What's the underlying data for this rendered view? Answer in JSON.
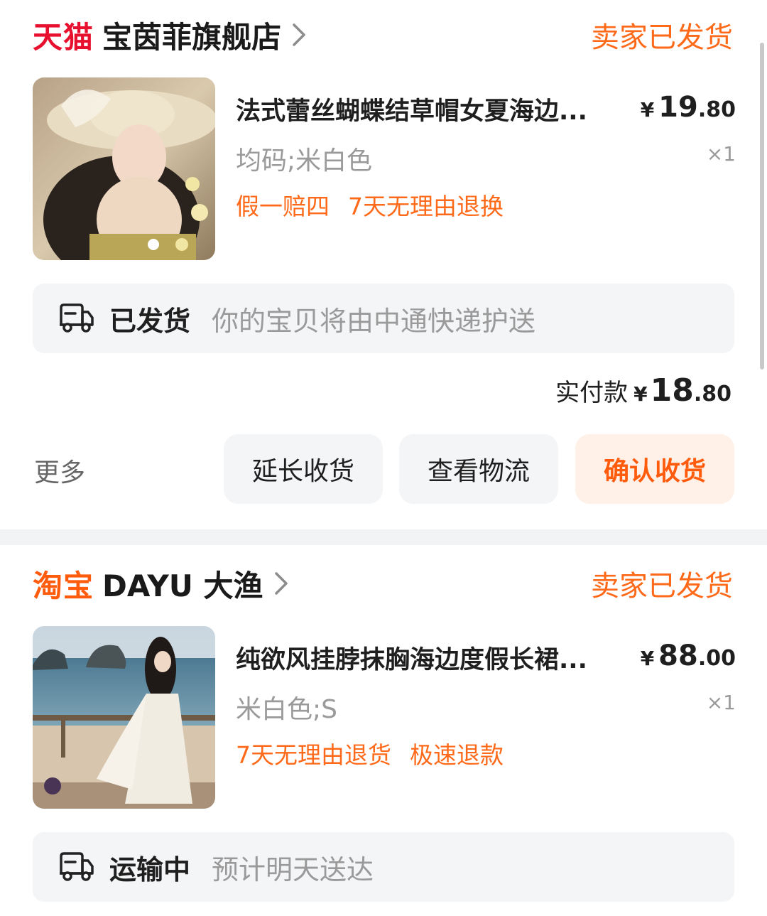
{
  "orders": [
    {
      "platform": "天猫",
      "shop_name": "宝茵菲旗舰店",
      "status": "卖家已发货",
      "product": {
        "title": "法式蕾丝蝴蝶结草帽女夏海边...",
        "price_symbol": "¥",
        "price_int": "19",
        "price_dec": ".80",
        "spec": "均码;米白色",
        "qty": "×1",
        "tags": [
          "假一赔四",
          "7天无理由退换"
        ]
      },
      "shipping": {
        "label": "已发货",
        "desc": "你的宝贝将由中通快递护送",
        "icon": "truck-icon"
      },
      "paid": {
        "label": "实付款",
        "symbol": "¥",
        "int": "18",
        "dec": ".80"
      },
      "more_label": "更多",
      "actions": [
        "延长收货",
        "查看物流",
        "确认收货"
      ]
    },
    {
      "platform": "淘宝",
      "shop_name": "DAYU 大渔",
      "status": "卖家已发货",
      "product": {
        "title": "纯欲风挂脖抹胸海边度假长裙...",
        "price_symbol": "¥",
        "price_int": "88",
        "price_dec": ".00",
        "spec": "米白色;S",
        "qty": "×1",
        "tags": [
          "7天无理由退货",
          "极速退款"
        ]
      },
      "shipping": {
        "label": "运输中",
        "desc": "预计明天送达",
        "icon": "truck-icon"
      }
    }
  ],
  "colors": {
    "accent": "#ff6a1a",
    "tmall": "#e8102f",
    "taobao": "#ff5b0c",
    "panel": "#f4f5f7"
  }
}
